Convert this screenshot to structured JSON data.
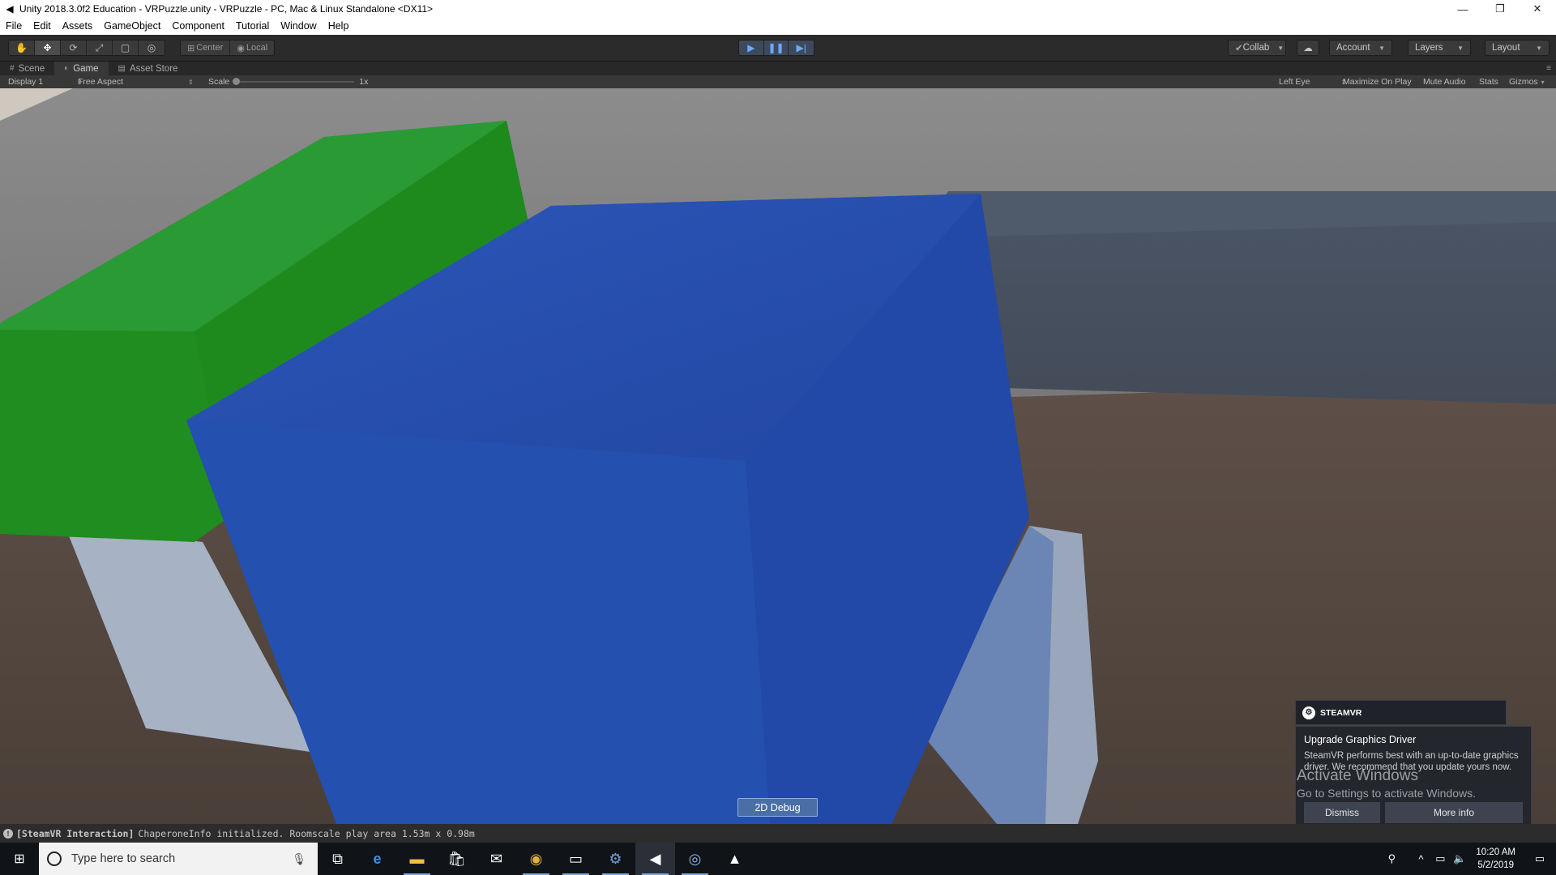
{
  "window": {
    "title": "Unity 2018.3.0f2 Education - VRPuzzle.unity - VRPuzzle - PC, Mac & Linux Standalone <DX11>",
    "minimize_icon": "minimize-icon",
    "maximize_icon": "restore-icon",
    "close_icon": "close-icon"
  },
  "menu": [
    "File",
    "Edit",
    "Assets",
    "GameObject",
    "Component",
    "Tutorial",
    "Window",
    "Help"
  ],
  "toolbar": {
    "tools": [
      "hand-icon",
      "move-icon",
      "rotate-icon",
      "scale-icon",
      "rect-tool-icon",
      "transform-tool-icon"
    ],
    "pivot": "Center",
    "space": "Local",
    "collab": "Collab",
    "account": "Account",
    "layers": "Layers",
    "layout": "Layout"
  },
  "tabs": [
    {
      "label": "Scene",
      "icon": "scene-icon"
    },
    {
      "label": "Game",
      "icon": "game-icon"
    },
    {
      "label": "Asset Store",
      "icon": "asset-store-icon"
    }
  ],
  "game_bar": {
    "display": "Display 1",
    "aspect": "Free Aspect",
    "scale_label": "Scale",
    "scale_value": "1x",
    "eye": "Left Eye",
    "maximize_on_play": "Maximize On Play",
    "mute_audio": "Mute Audio",
    "stats": "Stats",
    "gizmos": "Gizmos"
  },
  "viewport": {
    "debug_button": "2D Debug"
  },
  "steamvr": {
    "brand": "STEAMVR",
    "heading": "Upgrade Graphics Driver",
    "message": "SteamVR performs best with an up-to-date graphics driver. We recommend that you update yours now.",
    "dismiss": "Dismiss",
    "more_info": "More info"
  },
  "watermark": {
    "line1": "Activate Windows",
    "line2": "Go to Settings to activate Windows."
  },
  "status": {
    "tag": "[SteamVR Interaction]",
    "message": "ChaperoneInfo initialized. Roomscale play area 1.53m x 0.98m"
  },
  "taskbar": {
    "search_placeholder": "Type here to search",
    "time": "10:20 AM",
    "date": "5/2/2019"
  },
  "colors": {
    "green_cube": "#1f8a1f",
    "blue_cube": "#2450b0",
    "floor": "#5a4a3f",
    "sky": "#6a6a6a"
  }
}
